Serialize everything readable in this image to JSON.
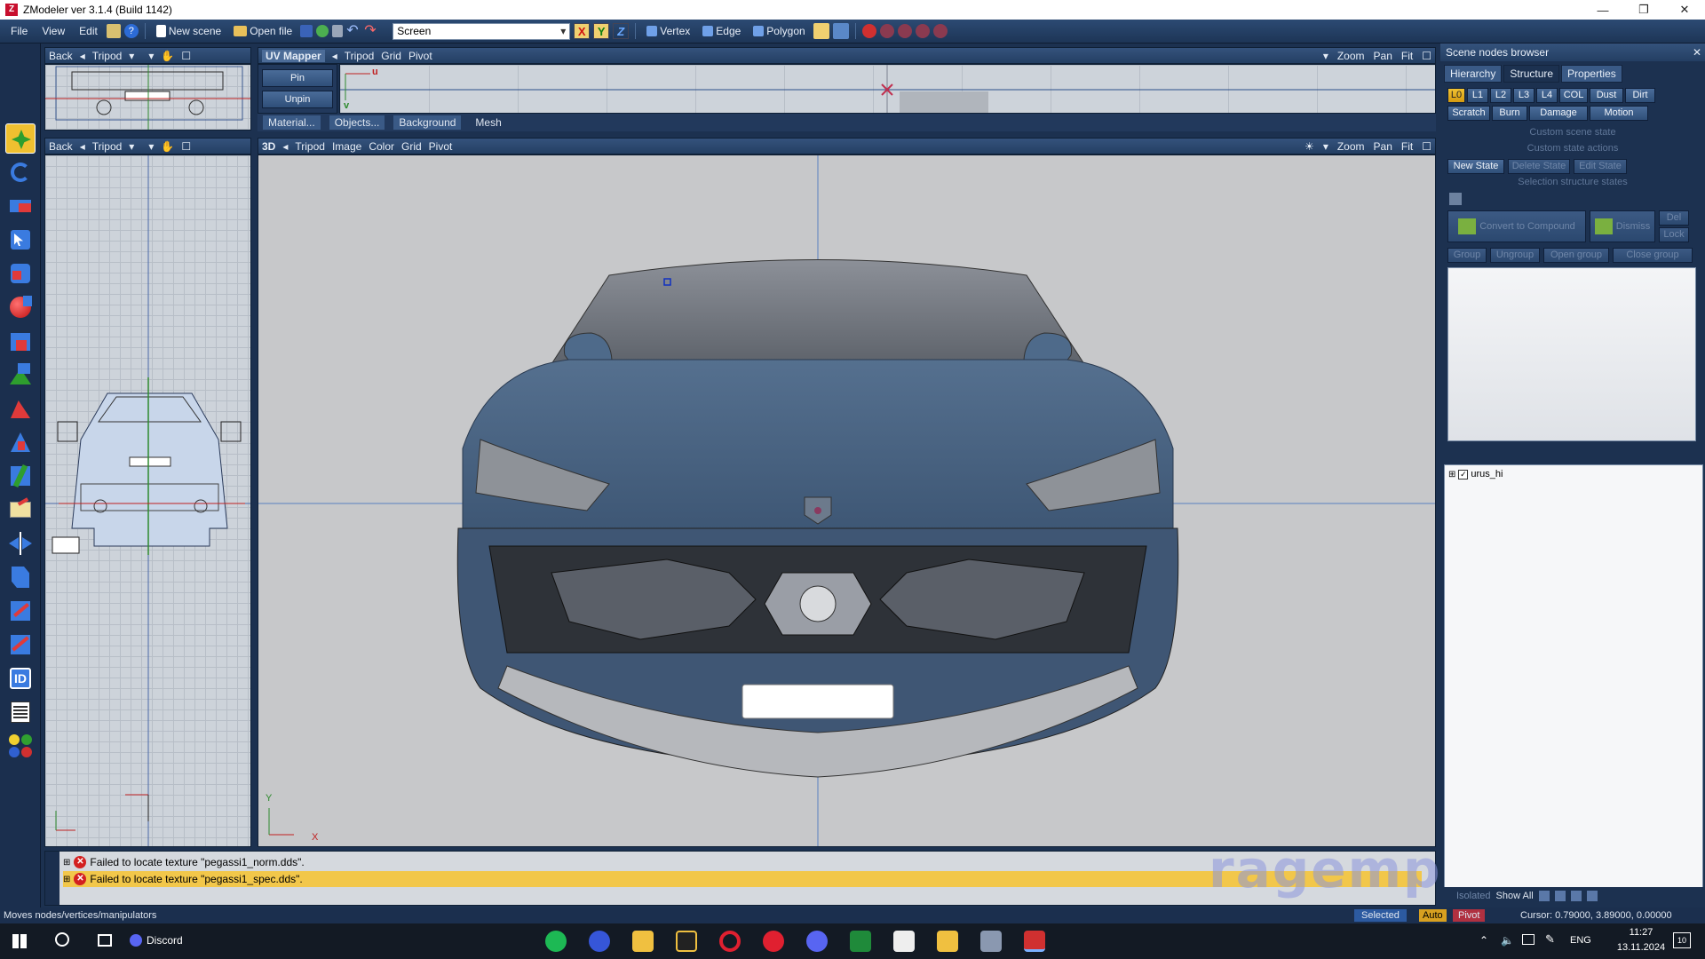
{
  "window": {
    "title": "ZModeler ver 3.1.4 (Build 1142)",
    "app_icon": "Z"
  },
  "menu": [
    "File",
    "View",
    "Edit"
  ],
  "toolbar": {
    "new_scene": "New scene",
    "open_file": "Open file",
    "mode_select": "Screen",
    "axis_x": "X",
    "axis_y": "Y",
    "axis_z": "Z",
    "vertex": "Vertex",
    "edge": "Edge",
    "polygon": "Polygon"
  },
  "viewports": {
    "top_left": {
      "view": "Back",
      "tripod": "Tripod"
    },
    "uv_mapper": {
      "title": "UV Mapper",
      "menu": [
        "Tripod",
        "Grid",
        "Pivot"
      ],
      "right": [
        "Zoom",
        "Pan",
        "Fit"
      ],
      "pin_label": "Pin",
      "unpin_label": "Unpin",
      "axis_u": "u",
      "axis_v": "v",
      "sub_tabs": [
        "Material...",
        "Objects...",
        "Background",
        "Mesh"
      ]
    },
    "left": {
      "view": "Back",
      "tripod": "Tripod"
    },
    "main": {
      "title": "3D",
      "menu": [
        "Tripod",
        "Image",
        "Color",
        "Grid",
        "Pivot"
      ],
      "right": [
        "Zoom",
        "Pan",
        "Fit"
      ],
      "axis_y": "Y",
      "axis_x": "X"
    }
  },
  "messages": [
    "Failed to locate texture \"pegassi1_norm.dds\".",
    "Failed to locate texture \"pegassi1_spec.dds\"."
  ],
  "watermark": "ragemp.pro",
  "scene_nodes": {
    "title": "Scene nodes browser",
    "tabs": [
      "Hierarchy",
      "Structure",
      "Properties"
    ],
    "lod_buttons": [
      "L0",
      "L1",
      "L2",
      "L3",
      "L4",
      "COL",
      "Dust",
      "Dirt"
    ],
    "effect_buttons": [
      "Scratch",
      "Burn",
      "Damage",
      "Motion"
    ],
    "custom_scene_state": "Custom scene state",
    "custom_state_actions": "Custom state actions",
    "state_buttons": [
      "New State",
      "Delete State",
      "Edit State"
    ],
    "selection_states": "Selection structure states",
    "convert_compound": "Convert to Compound",
    "dismiss": "Dismiss",
    "del": "Del",
    "lock": "Lock",
    "group_buttons": [
      "Group",
      "Ungroup",
      "Open group",
      "Close group"
    ],
    "tree_root": "urus_hi",
    "isolated": "Isolated",
    "show_all": "Show All"
  },
  "status": {
    "hint": "Moves nodes/vertices/manipulators",
    "selected": "Selected",
    "auto": "Auto",
    "pivot": "Pivot",
    "cursor": "Cursor: 0.79000, 3.89000, 0.00000"
  },
  "taskbar": {
    "discord_label": "Discord",
    "lang": "ENG",
    "time": "11:27",
    "date": "13.11.2024",
    "notif_count": "10"
  }
}
